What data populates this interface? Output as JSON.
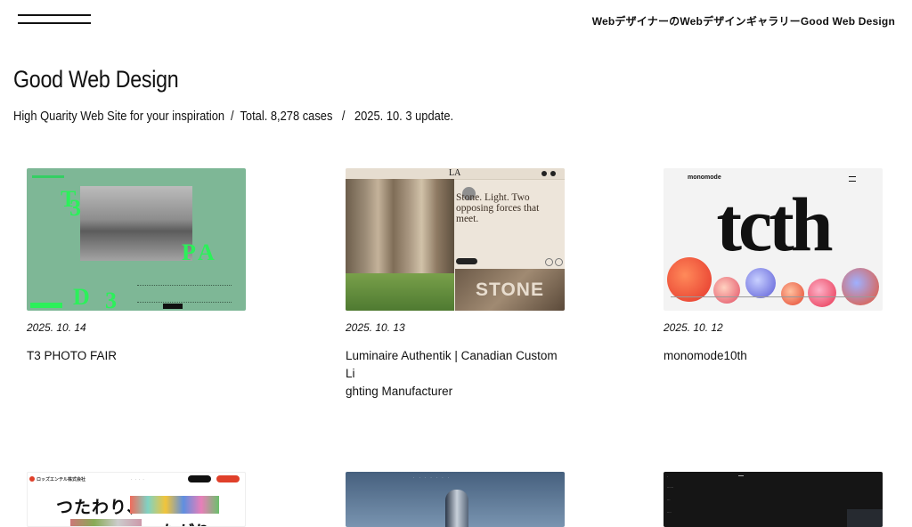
{
  "header": {
    "tagline": "WebデザイナーのWebデザインギャラリーGood Web Design"
  },
  "hero": {
    "title": "Good Web Design",
    "desc": "High Quarity Web Site for your inspiration",
    "total": "Total. 8,278 cases",
    "update": "2025. 10. 3 update."
  },
  "cards": [
    {
      "date": "2025. 10. 14",
      "title": "T3 PHOTO FAIR"
    },
    {
      "date": "2025. 10. 13",
      "title": "Luminaire Authentik | Canadian Custom Li\nghting Manufacturer"
    },
    {
      "date": "2025. 10. 12",
      "title": "monomode10th"
    }
  ],
  "thumbs": {
    "t2_logo": "LA",
    "t2_headline": "Stone. Light. Two opposing forces that meet.",
    "t2_stone": "STONE",
    "t3_brand": "monomode",
    "t3_big": "tcth",
    "t4_company": "ロッズエンテル株式会社",
    "t4_copy1": "つたわり、",
    "t4_copy2": "つながり"
  },
  "colors": {
    "green_thumb": "#7eb796",
    "beige_thumb": "#ede5da",
    "accent_red": "#e0402a"
  }
}
